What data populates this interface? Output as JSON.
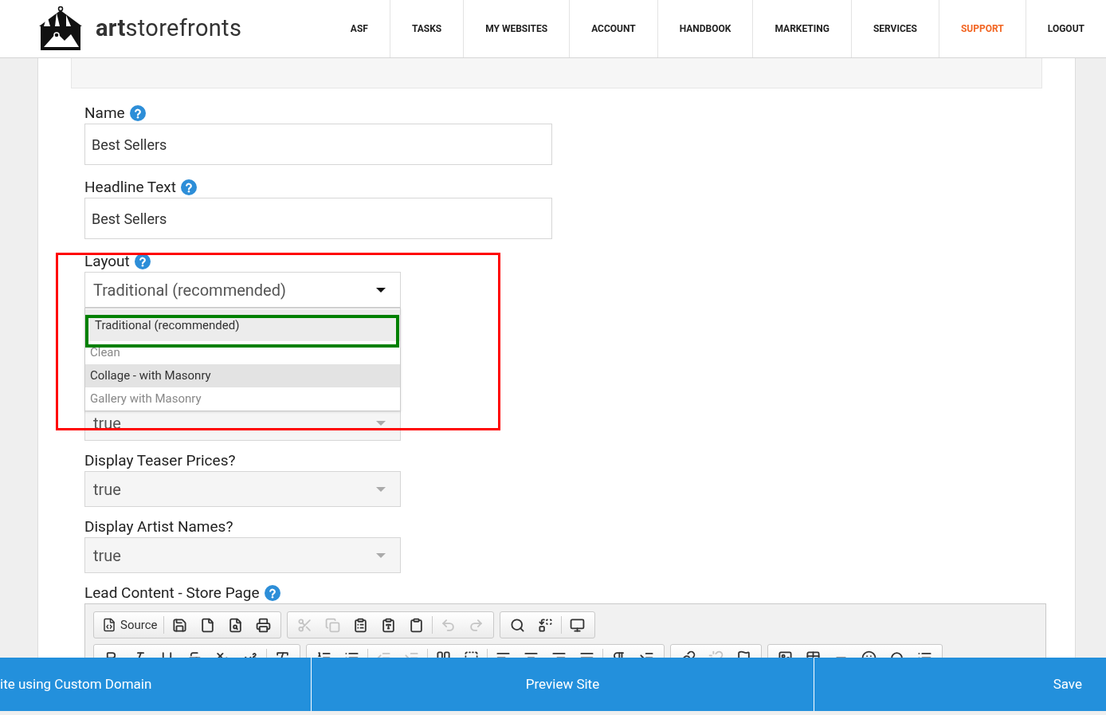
{
  "header": {
    "logo_text": "**art**storefronts",
    "nav": [
      {
        "label": "ASF",
        "selected": false
      },
      {
        "label": "TASKS",
        "selected": false
      },
      {
        "label": "MY WEBSITES",
        "selected": false
      },
      {
        "label": "ACCOUNT",
        "selected": false
      },
      {
        "label": "HANDBOOK",
        "selected": false
      },
      {
        "label": "MARKETING",
        "selected": false
      },
      {
        "label": "SERVICES",
        "selected": false
      },
      {
        "label": "SUPPORT",
        "selected": true
      },
      {
        "label": "LOGOUT",
        "selected": false
      }
    ]
  },
  "form": {
    "fields": [
      {
        "kind": "text",
        "label": "Name",
        "help": true,
        "value": "Best Sellers"
      },
      {
        "kind": "text",
        "label": "Headline Text",
        "help": true,
        "value": "Best Sellers"
      },
      {
        "kind": "select",
        "label": "Layout",
        "help": true,
        "value": "Traditional (recommended)",
        "expanded": true,
        "options": [
          {
            "label": "Traditional (recommended)",
            "selected": true,
            "highlighted": false
          },
          {
            "label": "Clean",
            "selected": false,
            "highlighted": false
          },
          {
            "label": "Collage - with Masonry",
            "selected": false,
            "highlighted": true
          },
          {
            "label": "Gallery with Masonry",
            "selected": false,
            "highlighted": false
          }
        ]
      },
      {
        "kind": "select",
        "value": "true",
        "expanded": false
      },
      {
        "kind": "select",
        "label": "Display Teaser Prices?",
        "value": "true",
        "expanded": false
      },
      {
        "kind": "select",
        "label": "Display Artist Names?",
        "value": "true",
        "expanded": false
      },
      {
        "kind": "editor",
        "label": "Lead Content - Store Page",
        "help": true,
        "source_label": "Source"
      }
    ]
  },
  "highlights": [
    {
      "color": "#ff0000"
    },
    {
      "color": "#008000"
    }
  ],
  "bottom_bar": [
    "ite using Custom Domain",
    "Preview Site",
    "Save"
  ]
}
